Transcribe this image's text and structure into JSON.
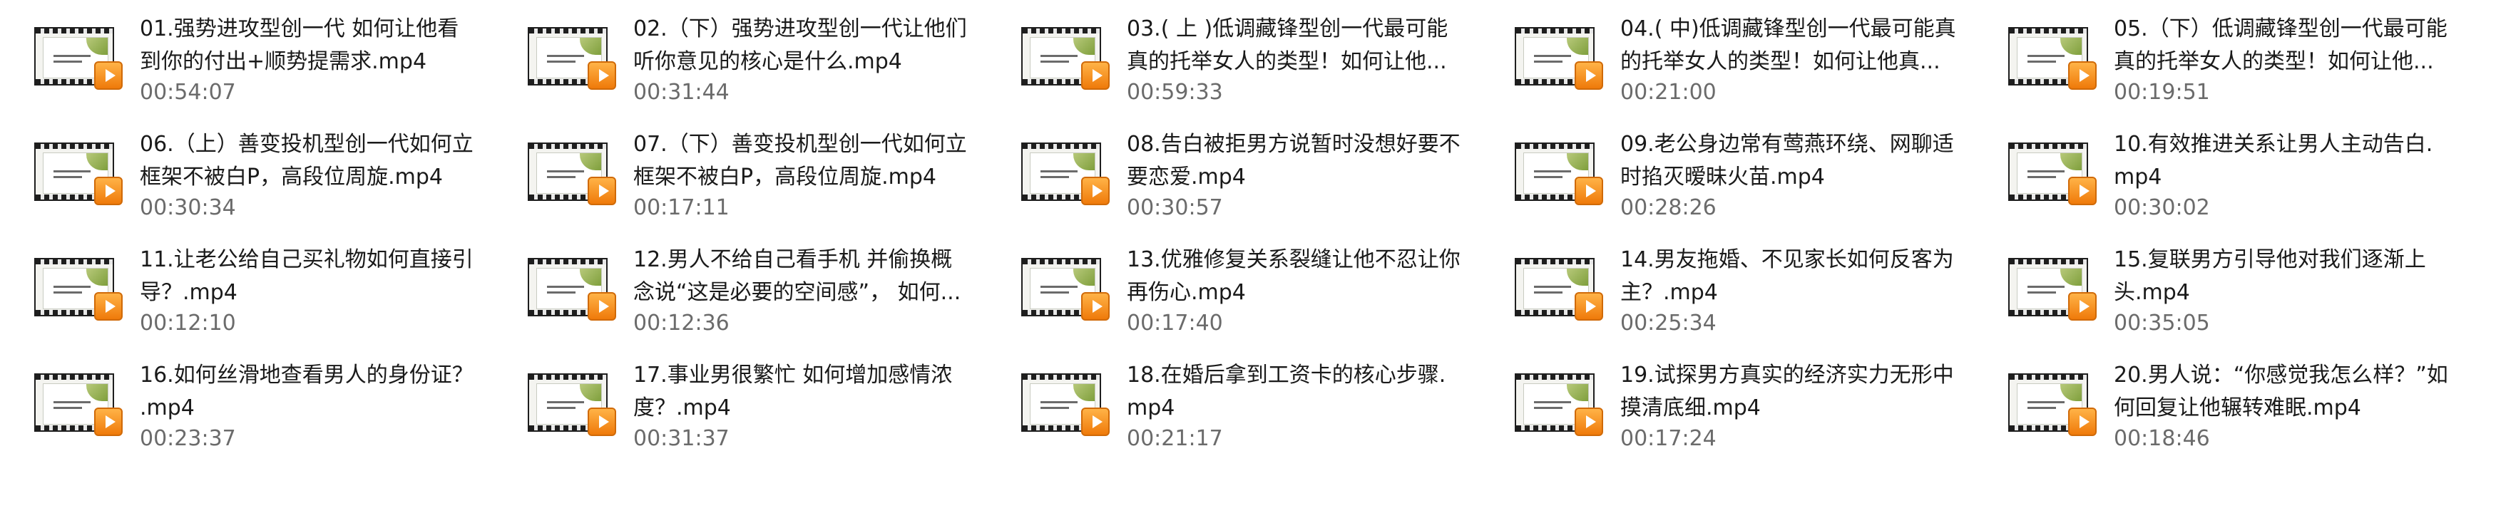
{
  "files": [
    {
      "name_line1": "01.强势进攻型创一代 如何让他看",
      "name_line2": "到你的付出+顺势提需求.mp4",
      "duration": "00:54:07",
      "icon": "video-file-icon"
    },
    {
      "name_line1": "02.（下）强势进攻型创一代让他们",
      "name_line2": "听你意见的核心是什么.mp4",
      "duration": "00:31:44",
      "icon": "video-file-icon"
    },
    {
      "name_line1": "03.( 上 )低调藏锋型创一代最可能",
      "name_line2": "真的托举女人的类型！如何让他...",
      "duration": "00:59:33",
      "icon": "video-file-icon"
    },
    {
      "name_line1": "04.( 中)低调藏锋型创一代最可能真",
      "name_line2": "的托举女人的类型！如何让他真...",
      "duration": "00:21:00",
      "icon": "video-file-icon"
    },
    {
      "name_line1": "05.（下）低调藏锋型创一代最可能",
      "name_line2": "真的托举女人的类型！如何让他...",
      "duration": "00:19:51",
      "icon": "video-file-icon"
    },
    {
      "name_line1": "06.（上）善变投机型创一代如何立",
      "name_line2": "框架不被白P，高段位周旋.mp4",
      "duration": "00:30:34",
      "icon": "video-file-icon"
    },
    {
      "name_line1": "07.（下）善变投机型创一代如何立",
      "name_line2": "框架不被白P，高段位周旋.mp4",
      "duration": "00:17:11",
      "icon": "video-file-icon"
    },
    {
      "name_line1": "08.告白被拒男方说暂时没想好要不",
      "name_line2": "要恋爱.mp4",
      "duration": "00:30:57",
      "icon": "video-file-icon"
    },
    {
      "name_line1": "09.老公身边常有莺燕环绕、网聊适",
      "name_line2": "时掐灭暧昧火苗.mp4",
      "duration": "00:28:26",
      "icon": "video-file-icon"
    },
    {
      "name_line1": "10.有效推进关系让男人主动告白.",
      "name_line2": "mp4",
      "duration": "00:30:02",
      "icon": "video-file-icon"
    },
    {
      "name_line1": "11.让老公给自己买礼物如何直接引",
      "name_line2": "导？.mp4",
      "duration": "00:12:10",
      "icon": "video-file-icon"
    },
    {
      "name_line1": "12.男人不给自己看手机 并偷换概",
      "name_line2": "念说“这是必要的空间感”， 如何...",
      "duration": "00:12:36",
      "icon": "video-file-icon"
    },
    {
      "name_line1": "13.优雅修复关系裂缝让他不忍让你",
      "name_line2": "再伤心.mp4",
      "duration": "00:17:40",
      "icon": "video-file-icon"
    },
    {
      "name_line1": "14.男友拖婚、不见家长如何反客为",
      "name_line2": "主？.mp4",
      "duration": "00:25:34",
      "icon": "video-file-icon"
    },
    {
      "name_line1": "15.复联男方引导他对我们逐渐上",
      "name_line2": "头.mp4",
      "duration": "00:35:05",
      "icon": "video-file-icon"
    },
    {
      "name_line1": "16.如何丝滑地查看男人的身份证？",
      "name_line2": ".mp4",
      "duration": "00:23:37",
      "icon": "video-file-icon"
    },
    {
      "name_line1": "17.事业男很繁忙 如何增加感情浓",
      "name_line2": "度？.mp4",
      "duration": "00:31:37",
      "icon": "video-file-icon"
    },
    {
      "name_line1": "18.在婚后拿到工资卡的核心步骤.",
      "name_line2": "mp4",
      "duration": "00:21:17",
      "icon": "video-file-icon"
    },
    {
      "name_line1": "19.试探男方真实的经济实力无形中",
      "name_line2": "摸清底细.mp4",
      "duration": "00:17:24",
      "icon": "video-file-icon"
    },
    {
      "name_line1": "20.男人说：“你感觉我怎么样？”如",
      "name_line2": "何回复让他辗转难眠.mp4",
      "duration": "00:18:46",
      "icon": "video-file-icon"
    }
  ]
}
